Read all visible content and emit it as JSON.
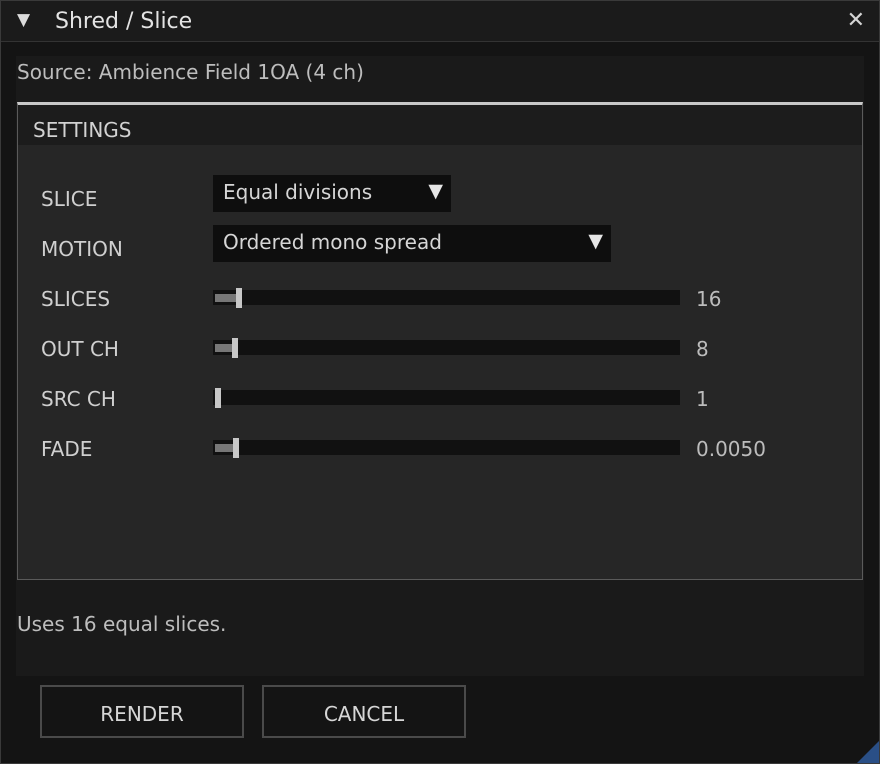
{
  "window": {
    "title": "Shred / Slice",
    "collapse_glyph": "▼",
    "close_glyph": "✕"
  },
  "source_line": "Source: Ambience Field 1OA  (4 ch)",
  "settings": {
    "title": "SETTINGS",
    "slice": {
      "label": "SLICE",
      "value": "Equal divisions"
    },
    "motion": {
      "label": "MOTION",
      "value": "Ordered mono spread"
    },
    "dropdown_glyph": "▼",
    "sliders": [
      {
        "label": "SLICES",
        "value": "16",
        "level": 0.05
      },
      {
        "label": "OUT CH",
        "value": "8",
        "level": 0.04
      },
      {
        "label": "SRC CH",
        "value": "1",
        "level": 0.0
      },
      {
        "label": "FADE",
        "value": "0.0050",
        "level": 0.042
      }
    ]
  },
  "status_text": "Uses 16 equal slices.",
  "buttons": {
    "render": "RENDER",
    "cancel": "CANCEL"
  },
  "icons": {
    "collapse": "triangle-down-icon",
    "close": "close-icon",
    "dropdown": "chevron-down-icon",
    "resize": "resize-grip-icon"
  },
  "colors": {
    "accent": "#2a4f86",
    "panel": "#262626",
    "background": "#141414"
  }
}
